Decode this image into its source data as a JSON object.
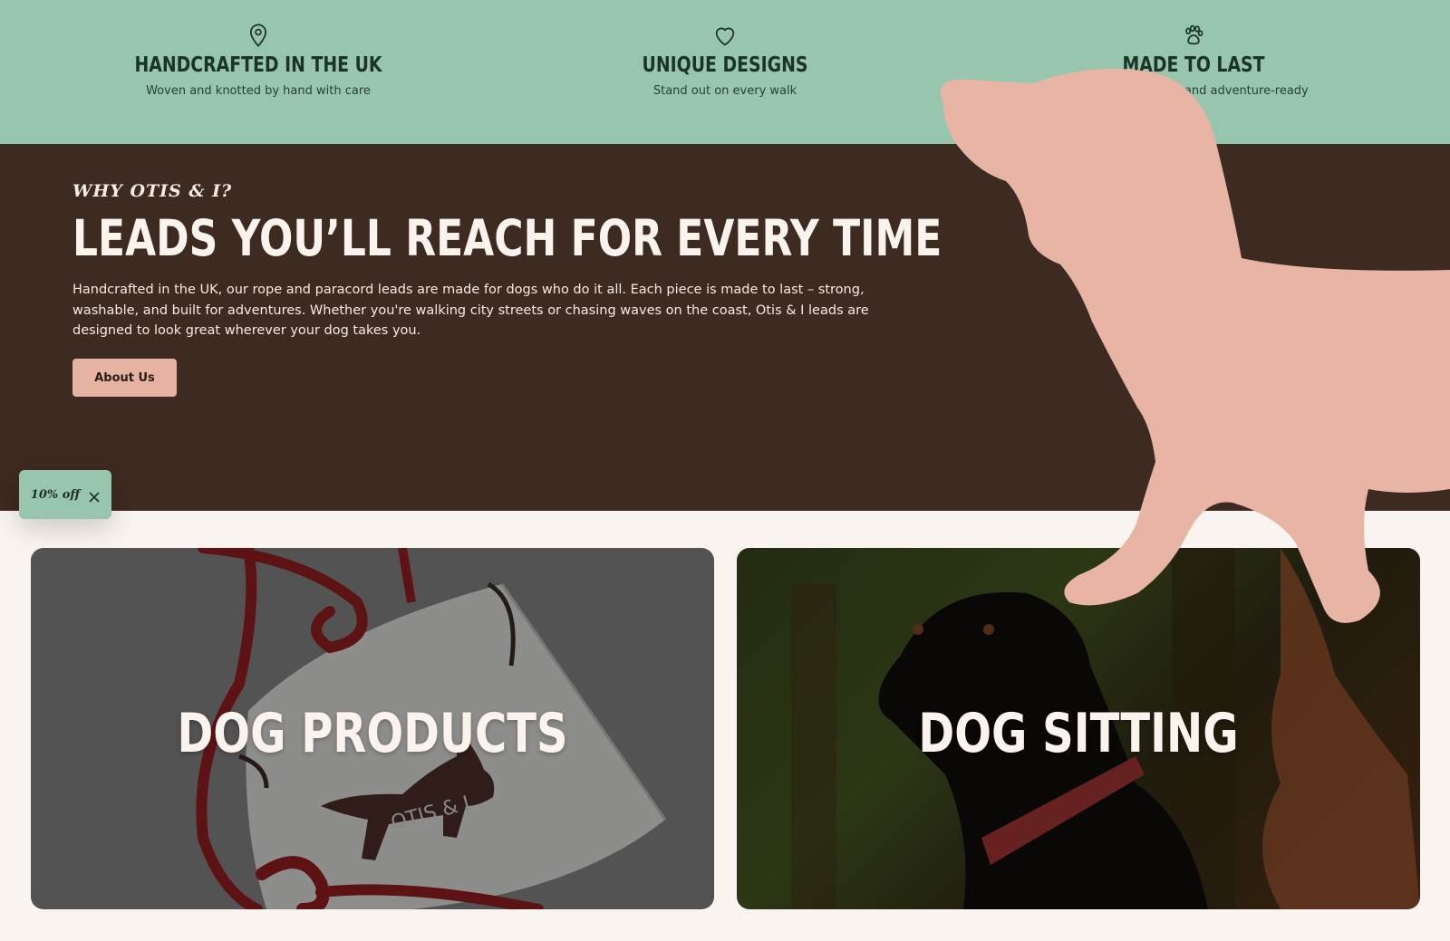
{
  "features": [
    {
      "icon": "map-pin-icon",
      "title": "HANDCRAFTED IN THE UK",
      "subtitle": "Woven and knotted by hand with care"
    },
    {
      "icon": "heart-icon",
      "title": "UNIQUE DESIGNS",
      "subtitle": "Stand out on every walk"
    },
    {
      "icon": "paw-icon",
      "title": "MADE TO LAST",
      "subtitle": "Strong, washable and adventure-ready"
    }
  ],
  "hero": {
    "eyebrow": "WHY OTIS & I?",
    "title": "LEADS YOU’LL REACH FOR EVERY TIME",
    "body": "Handcrafted in the UK, our rope and paracord leads are made for dogs who do it all. Each piece is made to last – strong, washable, and built for adventures. Whether you're walking city streets or chasing waves on the coast, Otis & I leads are designed to look great wherever your dog takes you.",
    "button_label": "About Us"
  },
  "discount": {
    "label": "10% off",
    "close_icon": "close-icon"
  },
  "cards": [
    {
      "title": "DOG PRODUCTS",
      "bag_text": "OTIS & I"
    },
    {
      "title": "DOG SITTING"
    }
  ],
  "colors": {
    "mint": "#97c5ad",
    "brown": "#3d2a21",
    "salmon": "#e6b3a2",
    "cream": "#faf4f0"
  }
}
